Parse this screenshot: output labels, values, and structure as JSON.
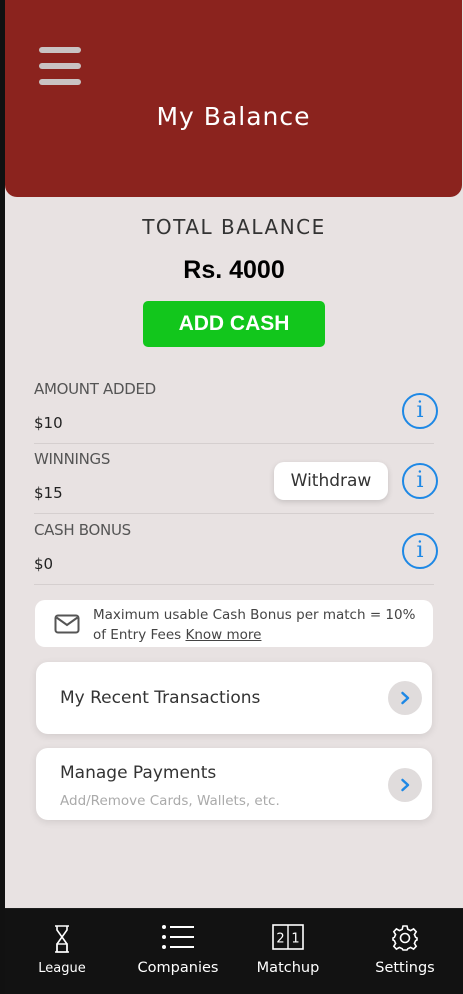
{
  "header": {
    "title": "My Balance"
  },
  "balance": {
    "total_label": "TOTAL BALANCE",
    "total_value": "Rs. 4000",
    "add_cash_label": "ADD CASH"
  },
  "rows": [
    {
      "label": "AMOUNT ADDED",
      "value": "$10"
    },
    {
      "label": "WINNINGS",
      "value": "$15",
      "action": "Withdraw"
    },
    {
      "label": "CASH BONUS",
      "value": "$0"
    }
  ],
  "notice": {
    "line1": "Maximum usable Cash Bonus per match = 10%",
    "line2": "of Entry Fees",
    "link": "Know more"
  },
  "cards": [
    {
      "title": "My Recent Transactions"
    },
    {
      "title": "Manage Payments",
      "subtitle": "Add/Remove Cards, Wallets, etc."
    }
  ],
  "nav": [
    {
      "label": "League",
      "icon": "hourglass-icon"
    },
    {
      "label": "Companies",
      "icon": "list-icon"
    },
    {
      "label": "Matchup",
      "icon": "matchup-icon"
    },
    {
      "label": "Settings",
      "icon": "gear-icon"
    }
  ],
  "colors": {
    "header": "#8b231e",
    "background": "#e8e2e2",
    "add_cash": "#12c61c",
    "info": "#1e88e5",
    "nav_bg": "#121212"
  }
}
